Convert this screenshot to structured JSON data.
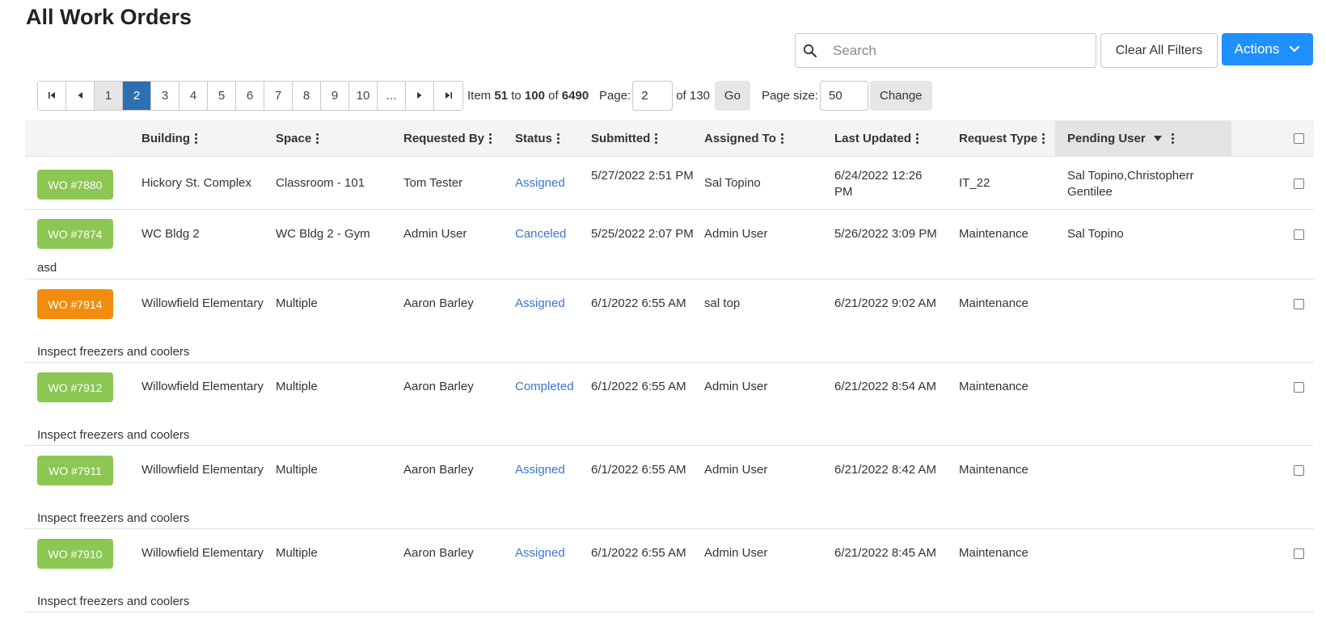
{
  "page_title": "All Work Orders",
  "toolbar": {
    "search_placeholder": "Search",
    "clear_filters_label": "Clear All Filters",
    "actions_label": "Actions"
  },
  "pager": {
    "pages": [
      "1",
      "2",
      "3",
      "4",
      "5",
      "6",
      "7",
      "8",
      "9",
      "10",
      "..."
    ],
    "active_page": "2",
    "info_item": "Item",
    "info_from": "51",
    "info_to_word": "to",
    "info_to": "100",
    "info_of_word": "of",
    "info_total": "6490",
    "page_label": "Page:",
    "page_value": "2",
    "of_pages": "of 130",
    "go_label": "Go",
    "page_size_label": "Page size:",
    "page_size_value": "50",
    "change_label": "Change"
  },
  "columns": {
    "building": "Building",
    "space": "Space",
    "requested_by": "Requested By",
    "status": "Status",
    "submitted": "Submitted",
    "assigned_to": "Assigned To",
    "last_updated": "Last Updated",
    "request_type": "Request Type",
    "pending_user": "Pending User"
  },
  "rows": [
    {
      "wo": "WO #7880",
      "color": "#8cc653",
      "building": "Hickory St. Complex",
      "space": "Classroom - 101",
      "requested_by": "Tom Tester",
      "status": "Assigned",
      "submitted": "5/27/2022 2:51 PM",
      "assigned_to": "Sal Topino",
      "last_updated": "6/24/2022 12:26 PM",
      "request_type": "IT_22",
      "pending_user": "Sal Topino,Christopherr Gentilee",
      "description": ""
    },
    {
      "wo": "WO #7874",
      "color": "#8cc653",
      "building": "WC Bldg 2",
      "space": "WC Bldg 2 - Gym",
      "requested_by": "Admin User",
      "status": "Canceled",
      "submitted": "5/25/2022 2:07 PM",
      "assigned_to": "Admin User",
      "last_updated": "5/26/2022 3:09 PM",
      "request_type": "Maintenance",
      "pending_user": "Sal Topino",
      "description": "asd"
    },
    {
      "wo": "WO #7914",
      "color": "#f28c0f",
      "building": "Willowfield Elementary",
      "space": "Multiple",
      "requested_by": "Aaron Barley",
      "status": "Assigned",
      "submitted": "6/1/2022 6:55 AM",
      "assigned_to": "sal top",
      "last_updated": "6/21/2022 9:02 AM",
      "request_type": "Maintenance",
      "pending_user": "",
      "description": "Inspect freezers and coolers"
    },
    {
      "wo": "WO #7912",
      "color": "#8cc653",
      "building": "Willowfield Elementary",
      "space": "Multiple",
      "requested_by": "Aaron Barley",
      "status": "Completed",
      "submitted": "6/1/2022 6:55 AM",
      "assigned_to": "Admin User",
      "last_updated": "6/21/2022 8:54 AM",
      "request_type": "Maintenance",
      "pending_user": "",
      "description": "Inspect freezers and coolers"
    },
    {
      "wo": "WO #7911",
      "color": "#8cc653",
      "building": "Willowfield Elementary",
      "space": "Multiple",
      "requested_by": "Aaron Barley",
      "status": "Assigned",
      "submitted": "6/1/2022 6:55 AM",
      "assigned_to": "Admin User",
      "last_updated": "6/21/2022 8:42 AM",
      "request_type": "Maintenance",
      "pending_user": "",
      "description": "Inspect freezers and coolers"
    },
    {
      "wo": "WO #7910",
      "color": "#8cc653",
      "building": "Willowfield Elementary",
      "space": "Multiple",
      "requested_by": "Aaron Barley",
      "status": "Assigned",
      "submitted": "6/1/2022 6:55 AM",
      "assigned_to": "Admin User",
      "last_updated": "6/21/2022 8:45 AM",
      "request_type": "Maintenance",
      "pending_user": "",
      "description": "Inspect freezers and coolers"
    }
  ]
}
